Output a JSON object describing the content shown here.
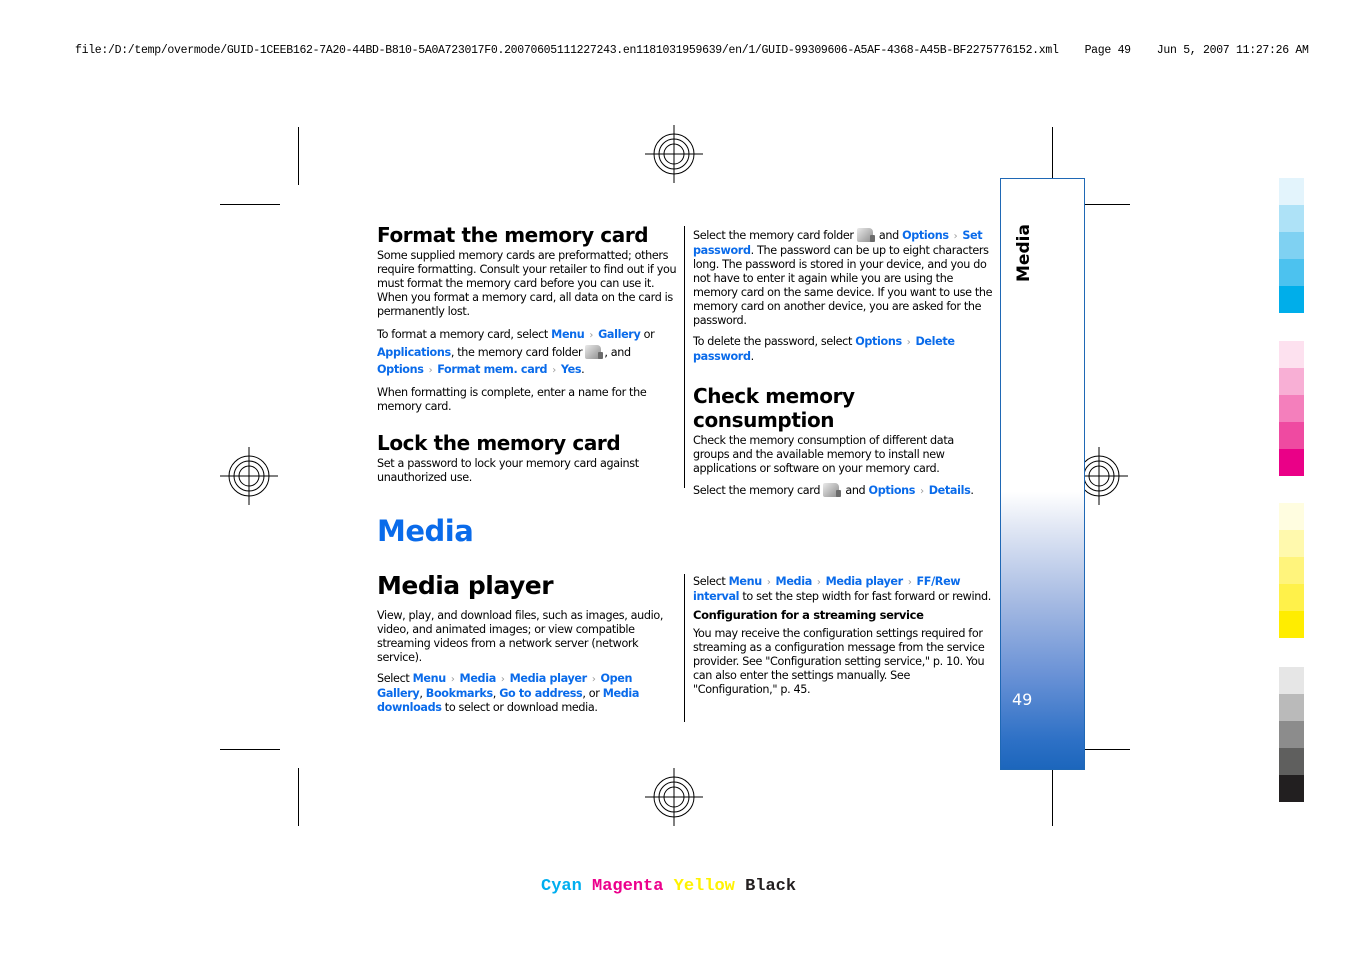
{
  "header": {
    "path": "file:/D:/temp/overmode/GUID-1CEEB162-7A20-44BD-B810-5A0A723017F0.20070605111227243.en1181031959639/en/1/GUID-99309606-A5AF-4368-A45B-BF2275776152.xml",
    "page": "Page 49",
    "datetime": "Jun 5, 2007 11:27:26 AM"
  },
  "sep_glyph": "›",
  "left_col": {
    "format_title": "Format the memory card",
    "format_body": "Some supplied memory cards are preformatted; others require formatting. Consult your retailer to find out if you must format the memory card before you can use it. When you format a memory card, all data on the card is permanently lost.",
    "format_steps": {
      "pre": "To format a memory card, select ",
      "menu": "Menu",
      "gallery": "Gallery",
      "or": " or ",
      "applications": "Applications",
      "mid": ", the memory card folder",
      "and": ", and",
      "options": "Options",
      "format_mem_card": "Format mem. card",
      "yes": "Yes",
      "end": "."
    },
    "format_after": "When formatting is complete, enter a name for the memory card.",
    "lock_title": "Lock the memory card",
    "lock_body": "Set a password to lock your memory card against unauthorized use."
  },
  "right_col": {
    "setpw": {
      "pre": "Select the memory card folder",
      "and": " and ",
      "options": "Options",
      "set_password": "Set password",
      "rest": ". The password can be up to eight characters long. The password is stored in your device, and you do not have to enter it again while you are using the memory card on the same device. If you want to use the memory card on another device, you are asked for the password."
    },
    "delpw": {
      "pre": "To delete the password, select ",
      "options": "Options",
      "delete_password": "Delete password",
      "end": "."
    },
    "check_title": "Check memory consumption",
    "check_body": "Check the memory consumption of different data groups and the available memory to install new applications or software on your memory card.",
    "details": {
      "pre": "Select the memory card",
      "and": " and ",
      "options": "Options",
      "details": "Details",
      "end": "."
    }
  },
  "section_title": "Media",
  "media_player": {
    "title": "Media player",
    "body": "View, play, and download files, such as images, audio, video, and animated images; or view compatible streaming videos from a network server (network service).",
    "select": {
      "pre": "Select ",
      "menu": "Menu",
      "media": "Media",
      "media_player": "Media player",
      "open_gallery": "Open Gallery",
      "comma": ", ",
      "bookmarks": "Bookmarks",
      "go_to_address": "Go to address",
      "or": ", or ",
      "media_downloads": "Media downloads",
      "end": " to select or download media."
    },
    "ffrew": {
      "pre": "Select ",
      "menu": "Menu",
      "media": "Media",
      "media_player": "Media player",
      "ff_rew_interval": "FF/Rew interval",
      "end": " to set the step width for fast forward or rewind."
    },
    "config_title": "Configuration for a streaming service",
    "config_body": "You may receive the configuration settings required for streaming as a configuration message from the service provider. See \"Configuration setting service,\" p. 10. You can also enter the settings manually. See \"Configuration,\" p. 45."
  },
  "side_tab": {
    "label": "Media",
    "page_number": "49"
  },
  "color_bar": {
    "cyan": [
      "#e3f4fc",
      "#aee2f7",
      "#7fd1f2",
      "#4cc2ef",
      "#00aeea"
    ],
    "magenta": [
      "#fde1ef",
      "#f8afd5",
      "#f47fbc",
      "#ef4aa1",
      "#ea0087"
    ],
    "yellow": [
      "#fffde0",
      "#fff9ad",
      "#fff47c",
      "#fff14a",
      "#ffed00"
    ],
    "black": [
      "#e6e6e6",
      "#bababa",
      "#8c8c8c",
      "#5f5f5e",
      "#221f20"
    ]
  },
  "cmyk_labels": {
    "cyan": "Cyan",
    "magenta": "Magenta",
    "yellow": "Yellow",
    "black": "Black",
    "colors": {
      "cyan": "#00aeef",
      "magenta": "#ec008c",
      "yellow": "#fff200",
      "black": "#231f20"
    }
  }
}
